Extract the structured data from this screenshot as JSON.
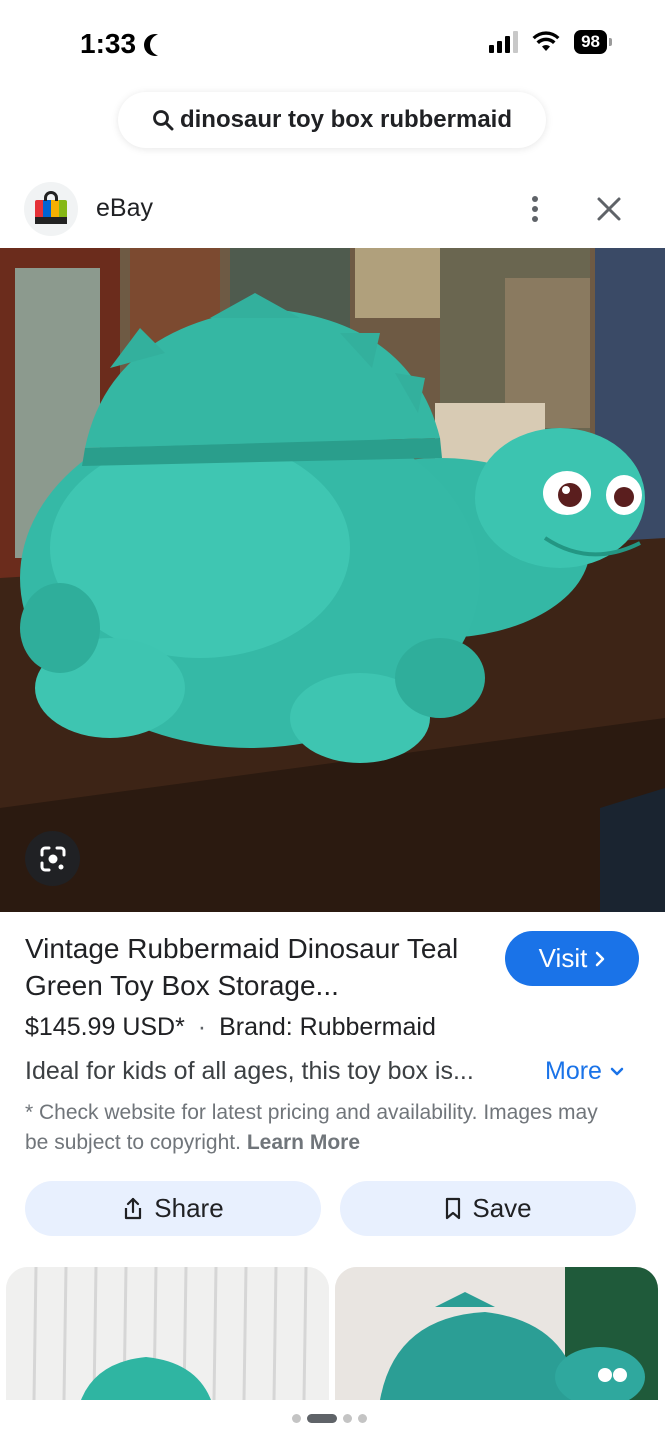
{
  "status_bar": {
    "time": "1:33",
    "battery": "98"
  },
  "search": {
    "query": "dinosaur toy box rubbermaid",
    "icon": "search-icon"
  },
  "source": {
    "name": "eBay",
    "favicon": "ebay-bag-icon"
  },
  "image": {
    "subject": "teal-dinosaur-toy-box"
  },
  "result": {
    "title": "Vintage Rubbermaid Dinosaur Teal Green Toy Box Storage...",
    "visit_label": "Visit",
    "price": "$145.99 USD*",
    "separator": "·",
    "brand": "Brand: Rubbermaid",
    "description": "Ideal for kids of all ages, this toy box is...",
    "more_label": "More",
    "disclaimer": "* Check website for latest pricing and availability. Images may be subject to copyright.",
    "learn_more": "Learn More"
  },
  "actions": {
    "share_label": "Share",
    "save_label": "Save"
  },
  "pager": {
    "count": 4,
    "active": 1
  },
  "colors": {
    "accent": "#1a73e8",
    "action_bg": "#e8f0fe",
    "dino_teal": "#2fb5a2"
  }
}
